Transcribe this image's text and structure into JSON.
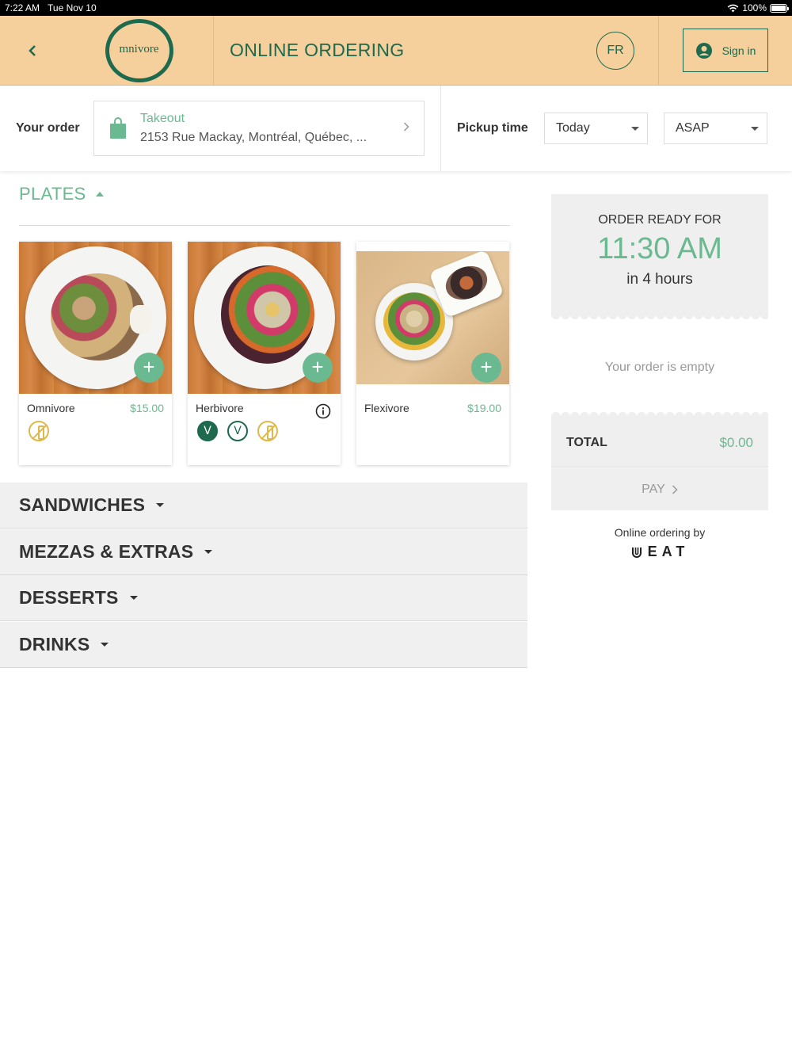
{
  "status_bar": {
    "time": "7:22 AM",
    "date": "Tue Nov 10",
    "battery": "100%"
  },
  "header": {
    "logo_text": "mnivore",
    "title": "ONLINE ORDERING",
    "language_button": "FR",
    "sign_in_label": "Sign in"
  },
  "order_bar": {
    "your_order_label": "Your order",
    "mode_label": "Takeout",
    "address": "2153 Rue Mackay, Montréal, Québec, ...",
    "pickup_label": "Pickup time",
    "day_value": "Today",
    "time_value": "ASAP"
  },
  "menu": {
    "open_section": "PLATES",
    "items": [
      {
        "name": "Omnivore",
        "price": "$15.00"
      },
      {
        "name": "Herbivore",
        "price": ""
      },
      {
        "name": "Flexivore",
        "price": "$19.00"
      }
    ],
    "categories": [
      "SANDWICHES",
      "MEZZAS & EXTRAS",
      "DESSERTS",
      "DRINKS"
    ]
  },
  "cart": {
    "ready_label": "ORDER READY FOR",
    "ready_time": "11:30 AM",
    "ready_in": "in 4 hours",
    "empty_text": "Your order is empty",
    "total_label": "TOTAL",
    "total_value": "$0.00",
    "pay_label": "PAY",
    "powered_by": "Online ordering by",
    "vendor": "EAT"
  },
  "colors": {
    "header_bg": "#f5cf9c",
    "brand_green": "#1d6a4f",
    "accent_green": "#6bb991",
    "panel_gray": "#efefef"
  }
}
